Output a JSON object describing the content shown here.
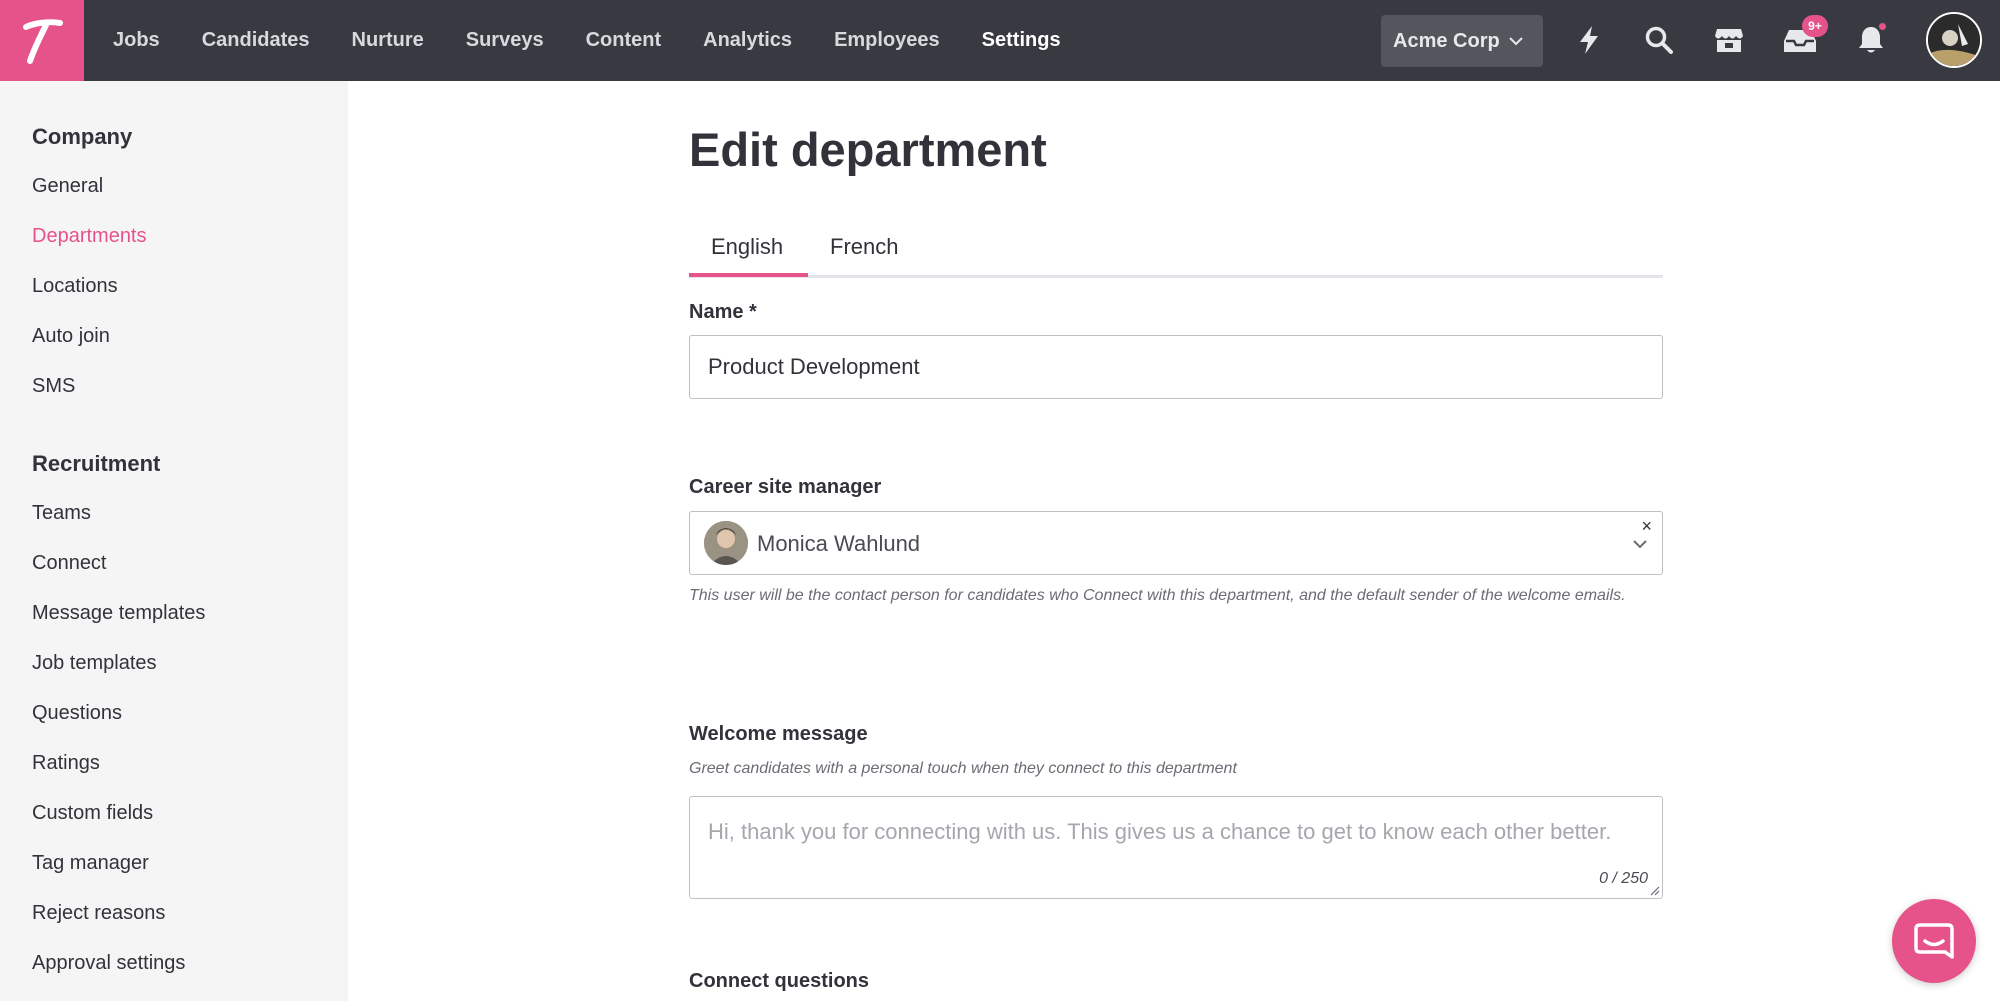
{
  "colors": {
    "brand": "#e6538a",
    "topbar": "#393a41",
    "sidebar": "#f5f5f6",
    "text": "#32333a"
  },
  "logo": {
    "letter": "T",
    "icon": "talentech-logo-icon"
  },
  "nav": {
    "items": [
      {
        "label": "Jobs"
      },
      {
        "label": "Candidates"
      },
      {
        "label": "Nurture"
      },
      {
        "label": "Surveys"
      },
      {
        "label": "Content"
      },
      {
        "label": "Analytics"
      },
      {
        "label": "Employees"
      },
      {
        "label": "Settings",
        "active": true
      }
    ]
  },
  "company_select": {
    "value": "Acme Corp",
    "icon": "chevron-down-icon"
  },
  "top_icons": {
    "lightning": "lightning-icon",
    "search": "search-icon",
    "store": "store-icon",
    "inbox": "inbox-icon",
    "inbox_badge": "9+",
    "bell": "bell-icon"
  },
  "sidebar": {
    "company_heading": "Company",
    "company_items": [
      {
        "label": "General"
      },
      {
        "label": "Departments",
        "active": true
      },
      {
        "label": "Locations"
      },
      {
        "label": "Auto join"
      },
      {
        "label": "SMS"
      }
    ],
    "recruitment_heading": "Recruitment",
    "recruitment_items": [
      {
        "label": "Teams"
      },
      {
        "label": "Connect"
      },
      {
        "label": "Message templates"
      },
      {
        "label": "Job templates"
      },
      {
        "label": "Questions"
      },
      {
        "label": "Ratings"
      },
      {
        "label": "Custom fields"
      },
      {
        "label": "Tag manager"
      },
      {
        "label": "Reject reasons"
      },
      {
        "label": "Approval settings"
      }
    ]
  },
  "main": {
    "title": "Edit department",
    "tabs": [
      {
        "label": "English",
        "active": true
      },
      {
        "label": "French"
      }
    ],
    "name": {
      "label": "Name *",
      "value": "Product Development"
    },
    "career_site_manager": {
      "label": "Career site manager",
      "value": "Monica Wahlund",
      "clear": "×",
      "help": "This user will be the contact person for candidates who Connect with this department, and the default sender of the welcome emails."
    },
    "welcome_message": {
      "label": "Welcome message",
      "help": "Greet candidates with a personal touch when they connect to this department",
      "placeholder": "Hi, thank you for connecting with us. This gives us a chance to get to know each other better.",
      "counter": "0 / 250"
    },
    "connect_questions": {
      "label": "Connect questions"
    }
  },
  "chat_launcher": {
    "icon": "chat-icon"
  }
}
